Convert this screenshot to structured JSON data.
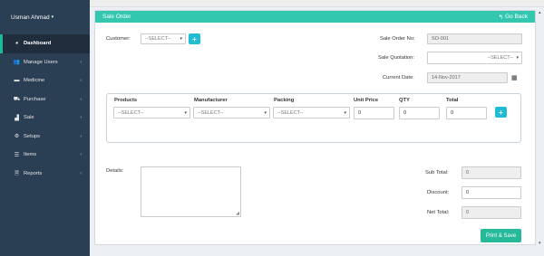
{
  "sidebar": {
    "user": "Usman Ahmad",
    "items": [
      {
        "label": "Dashboard",
        "icon": "dashboard-icon",
        "glyph": "◕",
        "active": true
      },
      {
        "label": "Manage Users",
        "icon": "users-icon",
        "glyph": "👥",
        "chevron": "‹"
      },
      {
        "label": "Medicine",
        "icon": "briefcase-icon",
        "glyph": "▬",
        "chevron": "‹"
      },
      {
        "label": "Purchase",
        "icon": "cart-icon",
        "glyph": "⛟",
        "chevron": "‹"
      },
      {
        "label": "Sale",
        "icon": "chart-icon",
        "glyph": "▟",
        "chevron": "‹"
      },
      {
        "label": "Setups",
        "icon": "gear-icon",
        "glyph": "⚙",
        "chevron": "‹"
      },
      {
        "label": "Items",
        "icon": "list-icon",
        "glyph": "☰",
        "chevron": "‹"
      },
      {
        "label": "Reports",
        "icon": "file-icon",
        "glyph": "🗎",
        "chevron": "‹"
      }
    ]
  },
  "panel": {
    "title": "Sale Order",
    "go_back": "Go Back",
    "customer_label": "Customer:",
    "customer_select": "--SELECT--",
    "sale_order_label": "Sale Order No:",
    "sale_order_value": "SO-001",
    "sale_quotation_label": "Sale Quotation:",
    "sale_quotation_select": "--SELECT--",
    "current_date_label": "Current Date:",
    "current_date_value": "14-Nov-2017",
    "products": {
      "headers": {
        "products": "Products",
        "manufacturer": "Manufacturer",
        "packing": "Packing",
        "unit_price": "Unit Price",
        "qty": "QTY",
        "total": "Total"
      },
      "products_select": "--SELECT--",
      "manufacturer_select": "--SELECT--",
      "packing_select": "--SELECT--",
      "unit_price": "0",
      "qty": "0",
      "total": "0"
    },
    "details_label": "Details:",
    "sub_total_label": "Sub Total:",
    "sub_total_value": "0",
    "discount_label": "Discount:",
    "discount_value": "0",
    "net_total_label": "Net Total:",
    "net_total_value": "0",
    "save_label": "Print & Save"
  },
  "colors": {
    "sidebar": "#2a3f54",
    "panel_header": "#33c7b0",
    "plus_button": "#1fbcd3",
    "save_button": "#26b99a"
  }
}
